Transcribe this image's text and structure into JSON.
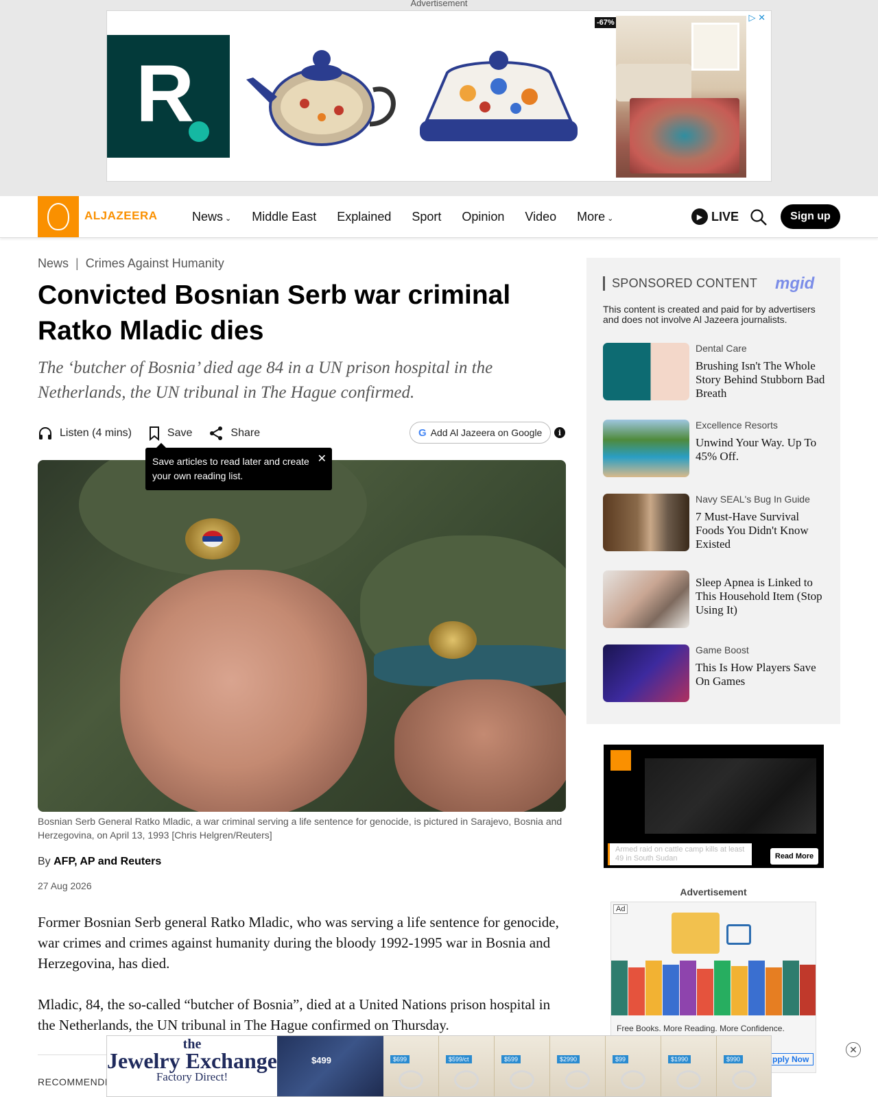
{
  "top_ad": {
    "label": "Advertisement",
    "discount": "-67%",
    "logo_letter": "R"
  },
  "nav": {
    "brand": "ALJAZEERA",
    "items": [
      {
        "label": "News",
        "has_dropdown": true
      },
      {
        "label": "Middle East",
        "has_dropdown": false
      },
      {
        "label": "Explained",
        "has_dropdown": false
      },
      {
        "label": "Sport",
        "has_dropdown": false
      },
      {
        "label": "Opinion",
        "has_dropdown": false
      },
      {
        "label": "Video",
        "has_dropdown": false
      },
      {
        "label": "More",
        "has_dropdown": true
      }
    ],
    "live_label": "LIVE",
    "signup_label": "Sign up"
  },
  "article": {
    "breadcrumb": {
      "section": "News",
      "topic": "Crimes Against Humanity"
    },
    "headline": "Convicted Bosnian Serb war criminal Ratko Mladic dies",
    "subhead": "The ‘butcher of Bosnia’ died age 84 in a UN prison hospital in the Netherlands, the UN tribunal in The Hague confirmed.",
    "actions": {
      "listen": "Listen (4 mins)",
      "save": "Save",
      "share": "Share",
      "google": "Add Al Jazeera on Google"
    },
    "tooltip": "Save articles to read later and create your own reading list.",
    "caption": "Bosnian Serb General Ratko Mladic, a war criminal serving a life sentence for genocide, is pictured in Sarajevo, Bosnia and Herzegovina, on April 13, 1993 [Chris Helgren/Reuters]",
    "byline_prefix": "By",
    "byline_authors": "AFP, AP and Reuters",
    "date": "27 Aug 2026",
    "paragraphs": [
      "Former Bosnian Serb general Ratko Mladic, who was serving a life sentence for genocide, war crimes and crimes against humanity during the bloody 1992-1995 war in Bosnia and Herzegovina, has died.",
      "Mladic, 84, the so-called “butcher of Bosnia”, died at a United Nations prison hospital in the Netherlands, the UN tribunal in The Hague confirmed on Thursday."
    ],
    "recommended_label": "RECOMMENDED"
  },
  "sponsored": {
    "title": "SPONSORED CONTENT",
    "provider": "mgid",
    "note": "This content is created and paid for by advertisers and does not involve Al Jazeera journalists.",
    "items": [
      {
        "source": "Dental Care",
        "headline": "Brushing Isn't The Whole Story Behind Stubborn Bad Breath"
      },
      {
        "source": "Excellence Resorts",
        "headline": "Unwind Your Way. Up To 45% Off."
      },
      {
        "source": "Navy SEAL's Bug In Guide",
        "headline": "7 Must-Have Survival Foods You Didn't Know Existed"
      },
      {
        "source": "",
        "headline": "Sleep Apnea is Linked to This Household Item (Stop Using It)"
      },
      {
        "source": "Game Boost",
        "headline": "This Is How Players Save On Games"
      }
    ]
  },
  "video_widget": {
    "ticker": "Armed raid on cattle camp kills at least 49 in South Sudan",
    "read_more": "Read More"
  },
  "side_ad": {
    "label": "Advertisement",
    "tag": "Ad",
    "text": "Free Books. More Reading. More Confidence.",
    "cta": "pply Now"
  },
  "bottom_ad": {
    "brand_line1": "the",
    "brand_line2": "Jewelry Exchange",
    "brand_line3": "Factory Direct!",
    "price": "$499",
    "ring_prices": [
      "$699",
      "$599/ct",
      "$599",
      "$2990",
      "$99",
      "$1990",
      "$990"
    ]
  }
}
